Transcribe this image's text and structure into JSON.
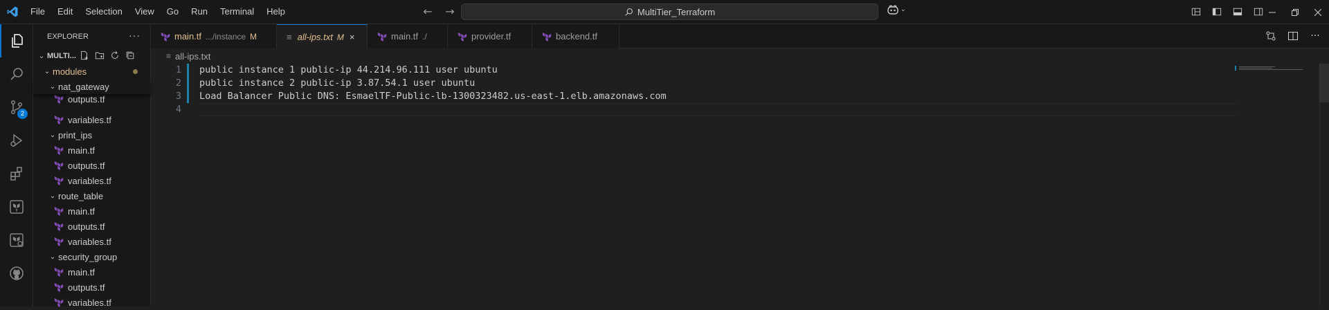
{
  "menu": [
    "File",
    "Edit",
    "Selection",
    "View",
    "Go",
    "Run",
    "Terminal",
    "Help"
  ],
  "command_center": {
    "label": "MultiTier_Terraform"
  },
  "explorer": {
    "header": "EXPLORER",
    "root_label": "MULTI...",
    "modules_label": "modules",
    "items": [
      {
        "label": "nat_gateway",
        "kind": "folder"
      },
      {
        "label": "outputs.tf",
        "kind": "file"
      },
      {
        "label": "variables.tf",
        "kind": "file"
      },
      {
        "label": "print_ips",
        "kind": "folder"
      },
      {
        "label": "main.tf",
        "kind": "file"
      },
      {
        "label": "outputs.tf",
        "kind": "file"
      },
      {
        "label": "variables.tf",
        "kind": "file"
      },
      {
        "label": "route_table",
        "kind": "folder"
      },
      {
        "label": "main.tf",
        "kind": "file"
      },
      {
        "label": "outputs.tf",
        "kind": "file"
      },
      {
        "label": "variables.tf",
        "kind": "file"
      },
      {
        "label": "security_group",
        "kind": "folder"
      },
      {
        "label": "main.tf",
        "kind": "file"
      },
      {
        "label": "outputs.tf",
        "kind": "file"
      },
      {
        "label": "variables.tf",
        "kind": "file"
      }
    ]
  },
  "scm_badge": "2",
  "tabs": [
    {
      "label": "main.tf",
      "desc": ".../instance",
      "mod": "M"
    },
    {
      "label": "all-ips.txt",
      "mod": "M",
      "close": "×"
    },
    {
      "label": "main.tf",
      "desc": "./"
    },
    {
      "label": "provider.tf"
    },
    {
      "label": "backend.tf"
    }
  ],
  "breadcrumb": "all-ips.txt",
  "editor": {
    "line_numbers": [
      "1",
      "2",
      "3",
      "4"
    ],
    "lines": [
      "public instance 1 public-ip 44.214.96.111 user ubuntu",
      "public instance 2 public-ip 3.87.54.1 user ubuntu",
      "Load Balancer Public DNS: EsmaelTF-Public-lb-1300323482.us-east-1.elb.amazonaws.com",
      ""
    ]
  },
  "colors": {
    "accent": "#0078d4",
    "modified": "#e2c08d",
    "terraform": "#844fba"
  }
}
